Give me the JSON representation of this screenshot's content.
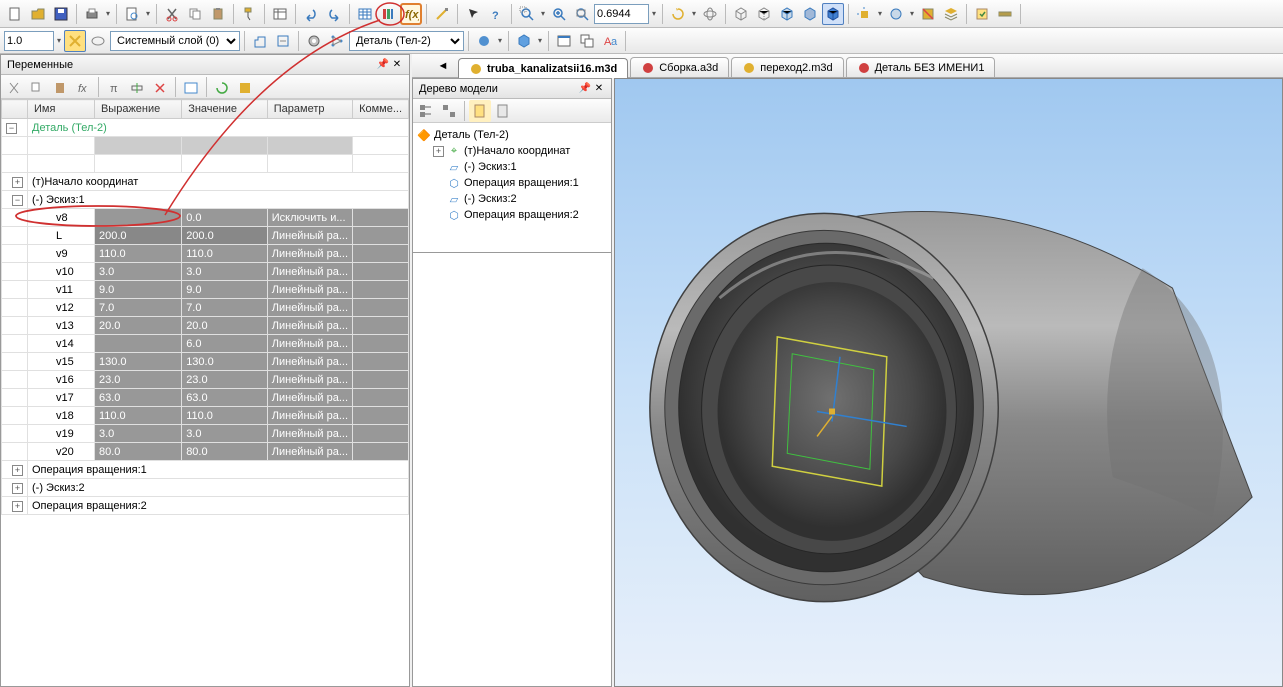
{
  "toolbar_main": {
    "zoom_value": "0.6944",
    "line_weight": "1.0",
    "layer_label": "Системный слой (0)",
    "part_label": "Деталь (Тел-2)"
  },
  "variables_panel": {
    "title": "Переменные",
    "columns": [
      "Имя",
      "Выражение",
      "Значение",
      "Параметр",
      "Комме..."
    ],
    "root": "Деталь (Тел-2)",
    "group1": "(т)Начало координат",
    "group2": "(-) Эскиз:1",
    "rows": [
      {
        "n": "v8",
        "e": "",
        "v": "0.0",
        "p": "Исключить и..."
      },
      {
        "n": "L",
        "e": "200.0",
        "v": "200.0",
        "p": "Линейный ра...",
        "hl": true
      },
      {
        "n": "v9",
        "e": "110.0",
        "v": "110.0",
        "p": "Линейный ра..."
      },
      {
        "n": "v10",
        "e": "3.0",
        "v": "3.0",
        "p": "Линейный ра..."
      },
      {
        "n": "v11",
        "e": "9.0",
        "v": "9.0",
        "p": "Линейный ра..."
      },
      {
        "n": "v12",
        "e": "7.0",
        "v": "7.0",
        "p": "Линейный ра..."
      },
      {
        "n": "v13",
        "e": "20.0",
        "v": "20.0",
        "p": "Линейный ра..."
      },
      {
        "n": "v14",
        "e": "",
        "v": "6.0",
        "p": "Линейный ра..."
      },
      {
        "n": "v15",
        "e": "130.0",
        "v": "130.0",
        "p": "Линейный ра..."
      },
      {
        "n": "v16",
        "e": "23.0",
        "v": "23.0",
        "p": "Линейный ра..."
      },
      {
        "n": "v17",
        "e": "63.0",
        "v": "63.0",
        "p": "Линейный ра..."
      },
      {
        "n": "v18",
        "e": "110.0",
        "v": "110.0",
        "p": "Линейный ра..."
      },
      {
        "n": "v19",
        "e": "3.0",
        "v": "3.0",
        "p": "Линейный ра..."
      },
      {
        "n": "v20",
        "e": "80.0",
        "v": "80.0",
        "p": "Линейный ра..."
      }
    ],
    "group3": "Операция вращения:1",
    "group4": "(-) Эскиз:2",
    "group5": "Операция вращения:2"
  },
  "model_tree": {
    "title": "Дерево модели",
    "root": "Деталь (Тел-2)",
    "nodes": [
      "(т)Начало координат",
      "(-) Эскиз:1",
      "Операция вращения:1",
      "(-) Эскиз:2",
      "Операция вращения:2"
    ]
  },
  "tabs": [
    {
      "label": "truba_kanalizatsii16.m3d",
      "active": true,
      "color": "#e0b030"
    },
    {
      "label": "Сборка.a3d",
      "active": false,
      "color": "#d04040"
    },
    {
      "label": "переход2.m3d",
      "active": false,
      "color": "#e0b030"
    },
    {
      "label": "Деталь БЕЗ ИМЕНИ1",
      "active": false,
      "color": "#d04040"
    }
  ]
}
